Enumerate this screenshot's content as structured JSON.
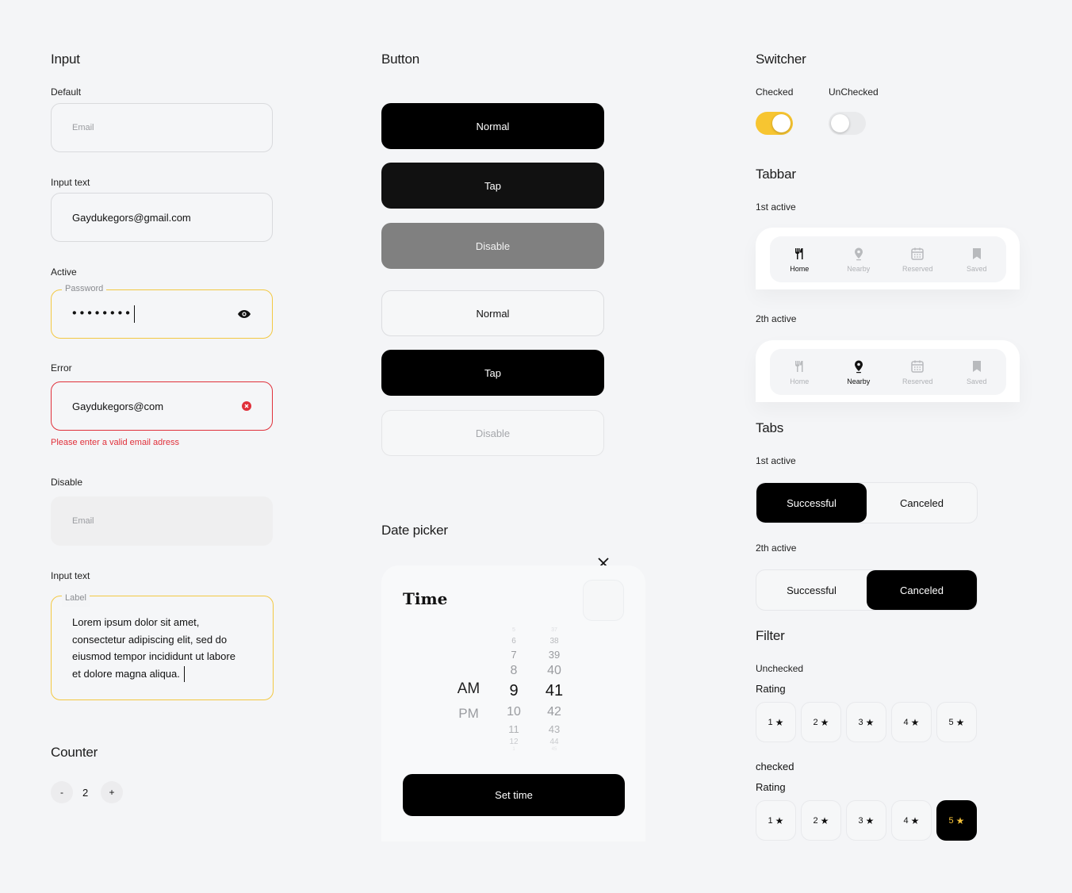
{
  "input": {
    "title": "Input",
    "default": {
      "label": "Default",
      "placeholder": "Email"
    },
    "text": {
      "label": "Input text",
      "value": "Gaydukegors@gmail.com"
    },
    "active": {
      "label": "Active",
      "float": "Password",
      "value": "••••••••"
    },
    "error": {
      "label": "Error",
      "value": "Gaydukegors@com",
      "message": "Please enter a valid email adress"
    },
    "disable": {
      "label": "Disable",
      "placeholder": "Email"
    },
    "textarea": {
      "label": "Input text",
      "float": "Label",
      "lines": [
        "Lorem ipsum dolor sit amet,",
        "consectetur adipiscing elit, sed do",
        "eiusmod tempor incididunt ut labore",
        "et dolore magna aliqua."
      ]
    }
  },
  "counter": {
    "title": "Counter",
    "minus": "-",
    "value": "2",
    "plus": "+"
  },
  "button": {
    "title": "Button",
    "items": [
      "Normal",
      "Tap",
      "Disable",
      "Normal",
      "Tap",
      "Disable"
    ]
  },
  "datepicker": {
    "title": "Date picker",
    "heading": "Time",
    "ampm": [
      "AM",
      "PM"
    ],
    "hours": [
      "5",
      "6",
      "7",
      "8",
      "9",
      "10",
      "11",
      "12",
      "1"
    ],
    "minutes": [
      "37",
      "38",
      "39",
      "40",
      "41",
      "42",
      "43",
      "44",
      "45"
    ],
    "action": "Set time"
  },
  "switcher": {
    "title": "Switcher",
    "checked": "Checked",
    "unchecked": "UnChecked",
    "accent": "#f7c531"
  },
  "tabbar": {
    "title": "Tabbar",
    "first_label": "1st active",
    "second_label": "2th active",
    "items": [
      "Home",
      "Nearby",
      "Reserved",
      "Saved"
    ]
  },
  "tabs": {
    "title": "Tabs",
    "first_label": "1st active",
    "second_label": "2th active",
    "items": [
      "Successful",
      "Canceled"
    ]
  },
  "filter": {
    "title": "Filter",
    "unchecked_label": "Unchecked",
    "checked_label": "checked",
    "rating_label": "Rating",
    "ratings": [
      "1",
      "2",
      "3",
      "4",
      "5"
    ]
  }
}
